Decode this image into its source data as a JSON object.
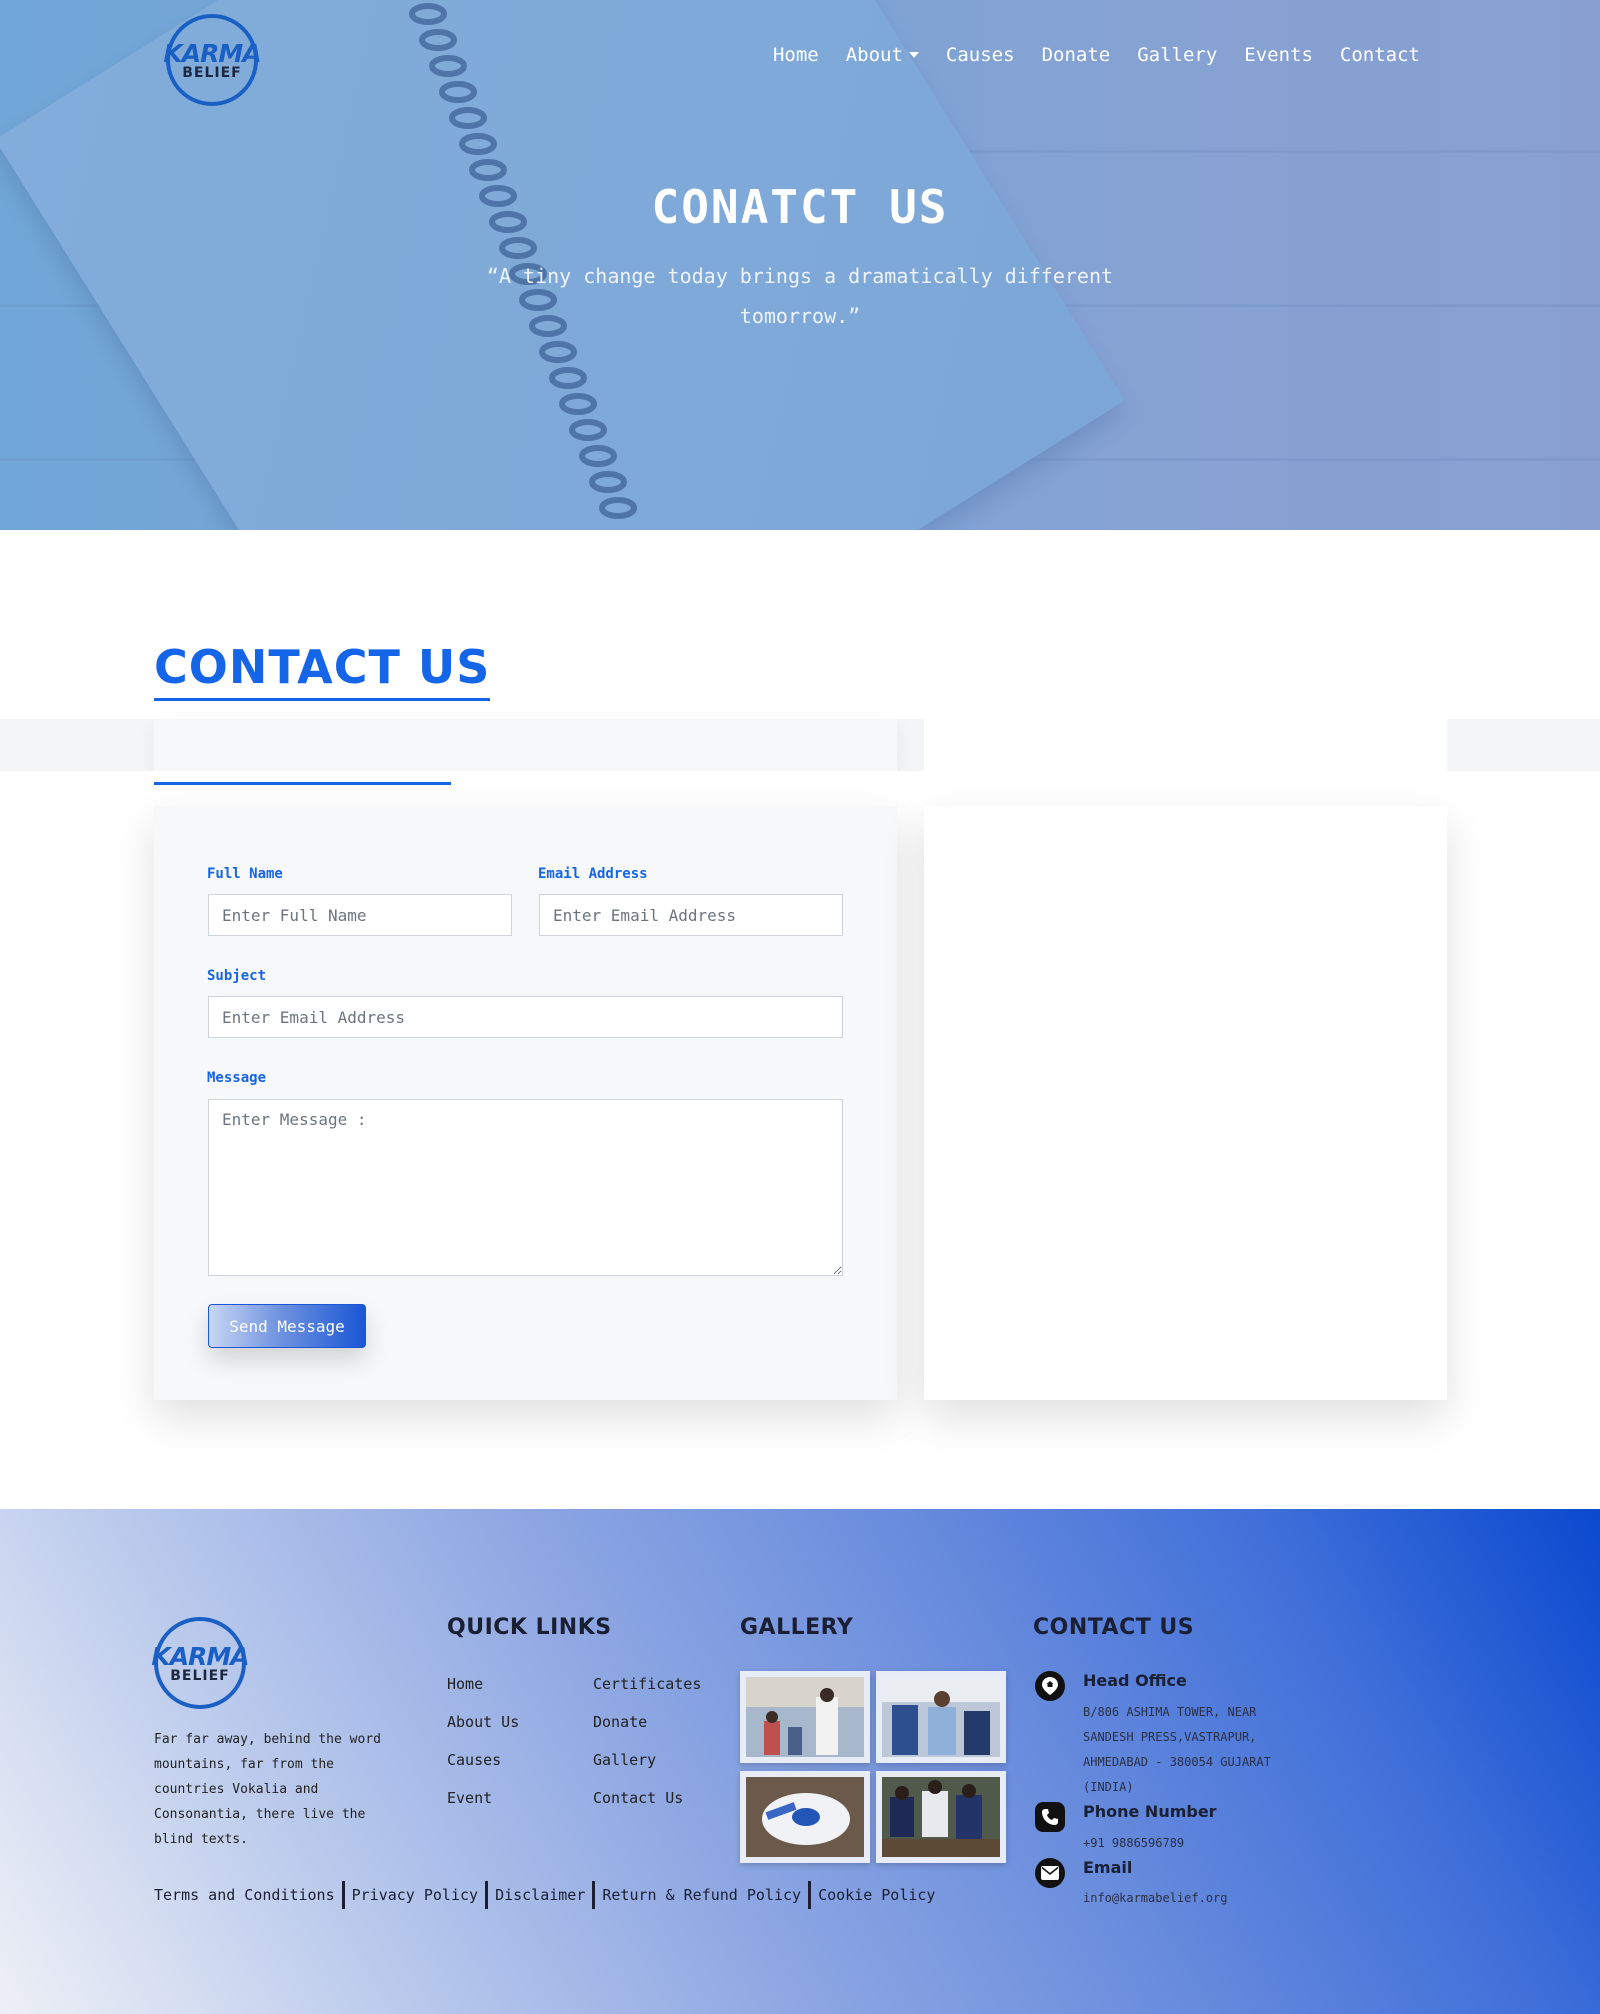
{
  "brand": {
    "logo_top": "KARMA",
    "logo_bottom": "BELIEF"
  },
  "nav": {
    "items": [
      "Home",
      "About",
      "Causes",
      "Donate",
      "Gallery",
      "Events",
      "Contact"
    ]
  },
  "hero": {
    "title": "CONATCT US",
    "quote": "“A tiny change today brings a dramatically different tomorrow.”"
  },
  "section": {
    "title": "CONTACT US"
  },
  "form": {
    "full_name_label": "Full Name",
    "full_name_placeholder": "Enter Full Name",
    "email_label": "Email Address",
    "email_placeholder": "Enter Email Address",
    "subject_label": "Subject",
    "subject_placeholder": "Enter Email Address",
    "message_label": "Message",
    "message_placeholder": "Enter Message :",
    "submit_label": "Send Message"
  },
  "footer": {
    "about_text": "Far far away, behind the word mountains, far from the countries Vokalia and Consonantia, there live the blind texts.",
    "quick_links_title": "QUICK LINKS",
    "quick_links": [
      "Home",
      "About Us",
      "Causes",
      "Event",
      "Certificates",
      "Donate",
      "Gallery",
      "Contact Us"
    ],
    "gallery_title": "GALLERY",
    "contact_title": "CONTACT US",
    "head_office_label": "Head Office",
    "head_office_address": "B/806 ASHIMA TOWER, NEAR SANDESH PRESS,VASTRAPUR, AHMEDABAD - 380054 GUJARAT (INDIA)",
    "phone_label": "Phone Number",
    "phone": "+91 9886596789",
    "email_label": "Email",
    "email": "info@karmabelief.org",
    "legal_links": [
      "Terms and Conditions",
      "Privacy Policy",
      "Disclaimer",
      "Return & Refund Policy",
      "Cookie Policy"
    ]
  },
  "colors": {
    "accent": "#1565e8",
    "brand_blue": "#1a5fc4",
    "footer_dark_blue": "#0a49cf"
  },
  "icons": [
    "location-pin-icon",
    "phone-icon",
    "envelope-icon"
  ]
}
